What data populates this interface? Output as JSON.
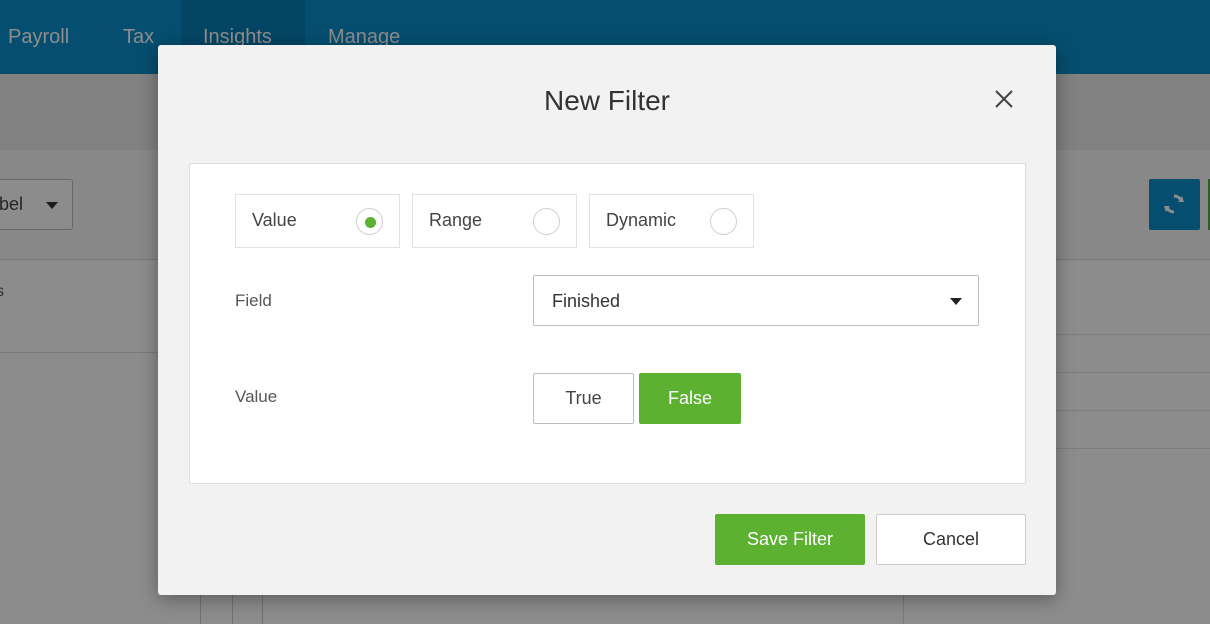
{
  "nav": {
    "items": [
      {
        "label": "Payroll"
      },
      {
        "label": "Tax"
      },
      {
        "label": "Insights"
      },
      {
        "label": "Manage"
      }
    ]
  },
  "background": {
    "select_text": "bel",
    "header_text": "s"
  },
  "modal": {
    "title": "New Filter",
    "filter_types": [
      {
        "label": "Value",
        "selected": true
      },
      {
        "label": "Range",
        "selected": false
      },
      {
        "label": "Dynamic",
        "selected": false
      }
    ],
    "field": {
      "label": "Field",
      "value": "Finished"
    },
    "value": {
      "label": "Value",
      "options": [
        {
          "label": "True",
          "selected": false
        },
        {
          "label": "False",
          "selected": true
        }
      ]
    },
    "save_label": "Save Filter",
    "cancel_label": "Cancel"
  },
  "colors": {
    "nav_blue": "#0b8fcb",
    "accent_green": "#5cb130"
  }
}
